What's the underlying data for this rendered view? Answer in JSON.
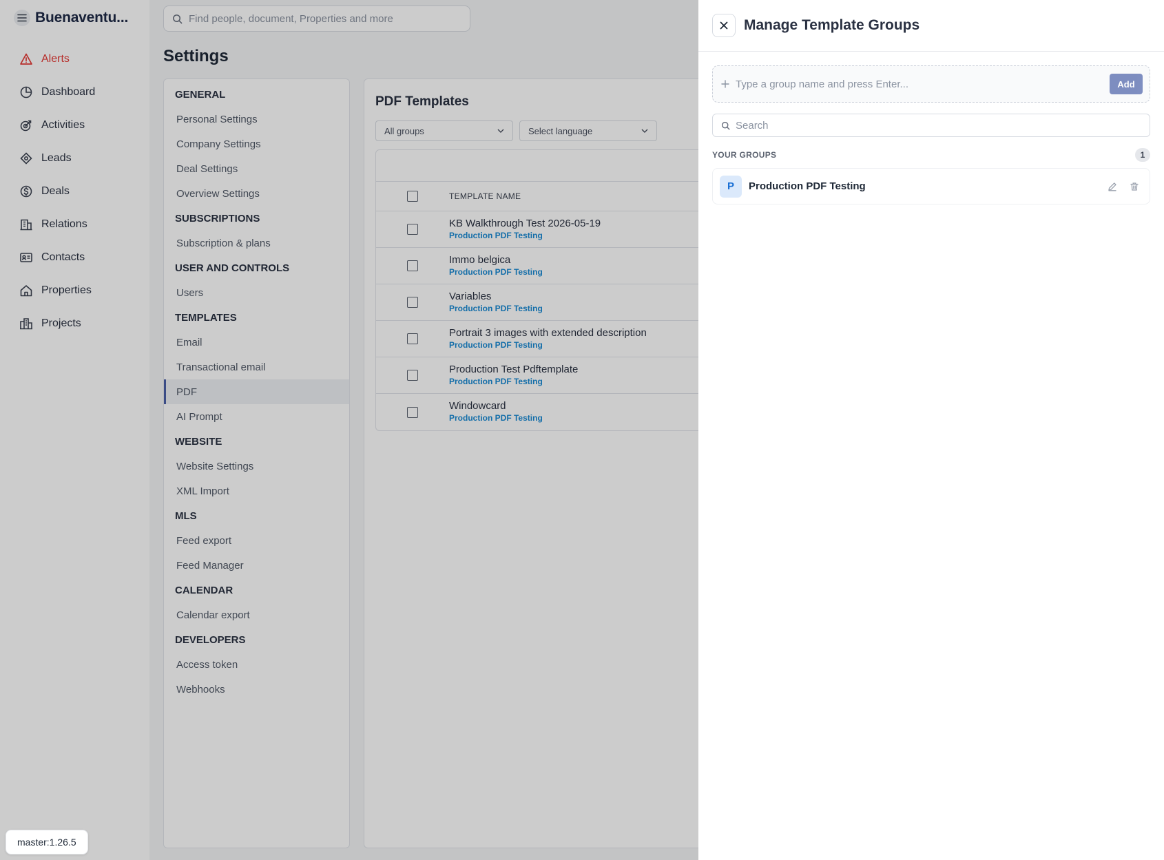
{
  "app": {
    "title": "Buenaventu...",
    "version": "master:1.26.5"
  },
  "nav": {
    "items": [
      {
        "label": "Alerts",
        "icon": "alert-triangle-icon"
      },
      {
        "label": "Dashboard",
        "icon": "chart-pie-icon"
      },
      {
        "label": "Activities",
        "icon": "activity-target-icon"
      },
      {
        "label": "Leads",
        "icon": "leads-icon"
      },
      {
        "label": "Deals",
        "icon": "dollar-circle-icon"
      },
      {
        "label": "Relations",
        "icon": "building-icon"
      },
      {
        "label": "Contacts",
        "icon": "id-card-icon"
      },
      {
        "label": "Properties",
        "icon": "home-icon"
      },
      {
        "label": "Projects",
        "icon": "city-icon"
      }
    ]
  },
  "search": {
    "placeholder": "Find people, document, Properties and more"
  },
  "page": {
    "title": "Settings"
  },
  "settings_menu": {
    "general": "GENERAL",
    "personal_settings": "Personal Settings",
    "company_settings": "Company Settings",
    "deal_settings": "Deal Settings",
    "overview_settings": "Overview Settings",
    "subscriptions": "SUBSCRIPTIONS",
    "subscription_plans": "Subscription & plans",
    "user_controls": "USER AND CONTROLS",
    "users": "Users",
    "templates": "TEMPLATES",
    "email": "Email",
    "transactional_email": "Transactional email",
    "pdf": "PDF",
    "ai_prompt": "AI Prompt",
    "website": "WEBSITE",
    "website_settings": "Website Settings",
    "xml_import": "XML Import",
    "mls": "MLS",
    "feed_export": "Feed export",
    "feed_manager": "Feed Manager",
    "calendar": "CALENDAR",
    "calendar_export": "Calendar export",
    "developers": "DEVELOPERS",
    "access_token": "Access token",
    "webhooks": "Webhooks"
  },
  "pdf_templates": {
    "title": "PDF Templates",
    "group_filter": "All groups",
    "language_filter": "Select language",
    "column_name": "TEMPLATE NAME",
    "rows": [
      {
        "name": "KB Walkthrough Test 2026-05-19",
        "group": "Production PDF Testing"
      },
      {
        "name": "Immo belgica",
        "group": "Production PDF Testing"
      },
      {
        "name": "Variables",
        "group": "Production PDF Testing"
      },
      {
        "name": "Portrait 3 images with extended description",
        "group": "Production PDF Testing"
      },
      {
        "name": "Production Test Pdftemplate",
        "group": "Production PDF Testing"
      },
      {
        "name": "Windowcard",
        "group": "Production PDF Testing"
      }
    ]
  },
  "drawer": {
    "title": "Manage Template Groups",
    "add_placeholder": "Type a group name and press Enter...",
    "add_button": "Add",
    "search_placeholder": "Search",
    "groups_label": "YOUR GROUPS",
    "groups_count": "1",
    "groups": [
      {
        "initial": "P",
        "name": "Production PDF Testing"
      }
    ]
  },
  "colors": {
    "accent": "#4a5fa8",
    "alert": "#e53935",
    "group_link": "#1a8ad4"
  }
}
